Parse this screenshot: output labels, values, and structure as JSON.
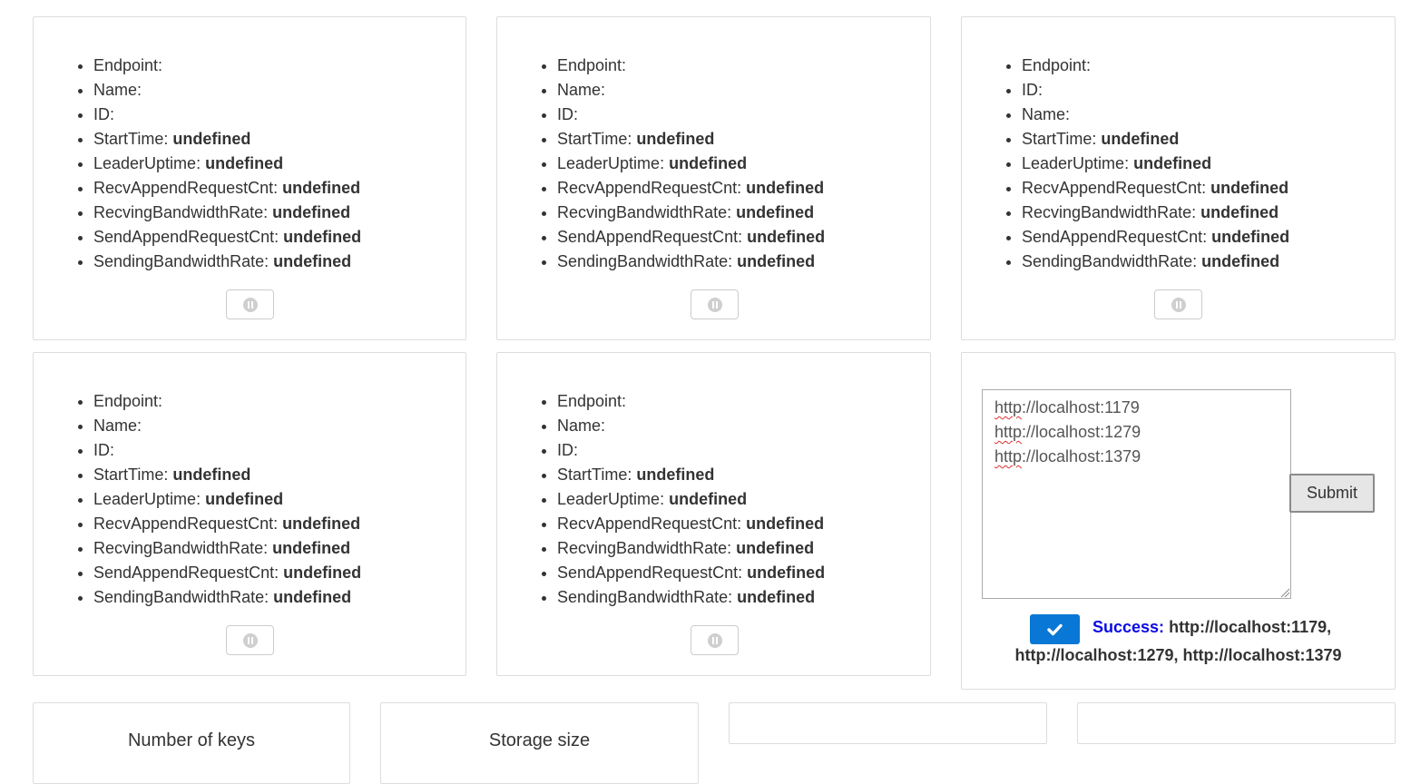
{
  "nodes": [
    {
      "stats": [
        {
          "label": "Endpoint:",
          "value": ""
        },
        {
          "label": "Name:",
          "value": ""
        },
        {
          "label": "ID:",
          "value": ""
        },
        {
          "label": "StartTime:",
          "value": "undefined"
        },
        {
          "label": "LeaderUptime:",
          "value": "undefined"
        },
        {
          "label": "RecvAppendRequestCnt:",
          "value": "undefined"
        },
        {
          "label": "RecvingBandwidthRate:",
          "value": "undefined"
        },
        {
          "label": "SendAppendRequestCnt:",
          "value": "undefined"
        },
        {
          "label": "SendingBandwidthRate:",
          "value": "undefined"
        }
      ]
    },
    {
      "stats": [
        {
          "label": "Endpoint:",
          "value": ""
        },
        {
          "label": "Name:",
          "value": ""
        },
        {
          "label": "ID:",
          "value": ""
        },
        {
          "label": "StartTime:",
          "value": "undefined"
        },
        {
          "label": "LeaderUptime:",
          "value": "undefined"
        },
        {
          "label": "RecvAppendRequestCnt:",
          "value": "undefined"
        },
        {
          "label": "RecvingBandwidthRate:",
          "value": "undefined"
        },
        {
          "label": "SendAppendRequestCnt:",
          "value": "undefined"
        },
        {
          "label": "SendingBandwidthRate:",
          "value": "undefined"
        }
      ]
    },
    {
      "stats": [
        {
          "label": "Endpoint:",
          "value": ""
        },
        {
          "label": "ID:",
          "value": ""
        },
        {
          "label": "Name:",
          "value": ""
        },
        {
          "label": "StartTime:",
          "value": "undefined"
        },
        {
          "label": "LeaderUptime:",
          "value": "undefined"
        },
        {
          "label": "RecvAppendRequestCnt:",
          "value": "undefined"
        },
        {
          "label": "RecvingBandwidthRate:",
          "value": "undefined"
        },
        {
          "label": "SendAppendRequestCnt:",
          "value": "undefined"
        },
        {
          "label": "SendingBandwidthRate:",
          "value": "undefined"
        }
      ]
    },
    {
      "stats": [
        {
          "label": "Endpoint:",
          "value": ""
        },
        {
          "label": "Name:",
          "value": ""
        },
        {
          "label": "ID:",
          "value": ""
        },
        {
          "label": "StartTime:",
          "value": "undefined"
        },
        {
          "label": "LeaderUptime:",
          "value": "undefined"
        },
        {
          "label": "RecvAppendRequestCnt:",
          "value": "undefined"
        },
        {
          "label": "RecvingBandwidthRate:",
          "value": "undefined"
        },
        {
          "label": "SendAppendRequestCnt:",
          "value": "undefined"
        },
        {
          "label": "SendingBandwidthRate:",
          "value": "undefined"
        }
      ]
    },
    {
      "stats": [
        {
          "label": "Endpoint:",
          "value": ""
        },
        {
          "label": "Name:",
          "value": ""
        },
        {
          "label": "ID:",
          "value": ""
        },
        {
          "label": "StartTime:",
          "value": "undefined"
        },
        {
          "label": "LeaderUptime:",
          "value": "undefined"
        },
        {
          "label": "RecvAppendRequestCnt:",
          "value": "undefined"
        },
        {
          "label": "RecvingBandwidthRate:",
          "value": "undefined"
        },
        {
          "label": "SendAppendRequestCnt:",
          "value": "undefined"
        },
        {
          "label": "SendingBandwidthRate:",
          "value": "undefined"
        }
      ]
    }
  ],
  "pause_icon": "pause-circle-icon",
  "endpoints_form": {
    "endpoints": [
      {
        "scheme": "http",
        "rest": "://localhost:1179"
      },
      {
        "scheme": "http",
        "rest": "://localhost:1279"
      },
      {
        "scheme": "http",
        "rest": "://localhost:1379"
      }
    ],
    "submit_label": "Submit",
    "status_icon": "check-icon",
    "status_label": "Success:",
    "status_line1": "http://localhost:1179,",
    "status_line2": "http://localhost:1279, http://localhost:1379"
  },
  "metrics": {
    "keys_title": "Number of keys",
    "storage_title": "Storage size"
  },
  "colors": {
    "border": "#dddddd",
    "accent_blue": "#0877d6",
    "success_label": "#0a0ae6",
    "text": "#333333"
  }
}
